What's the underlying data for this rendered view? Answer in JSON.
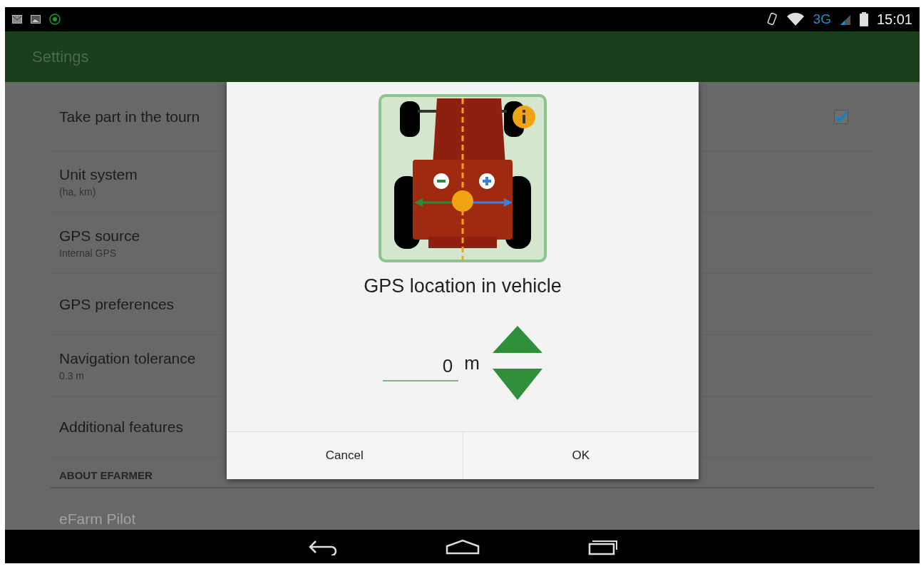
{
  "status_bar": {
    "network": "3G",
    "time": "15:01"
  },
  "action_bar": {
    "title": "Settings"
  },
  "settings": [
    {
      "kind": "checkbox",
      "title": "Take part in the tourn",
      "checked": true,
      "disabled": false
    },
    {
      "kind": "item",
      "title": "Unit system",
      "summary": "(ha, km)",
      "disabled": false
    },
    {
      "kind": "item",
      "title": "GPS source",
      "summary": "Internal GPS",
      "disabled": false
    },
    {
      "kind": "item",
      "title": "GPS preferences",
      "disabled": false
    },
    {
      "kind": "item",
      "title": "Navigation tolerance",
      "summary": "0.3 m",
      "disabled": false
    },
    {
      "kind": "item",
      "title": "Additional features",
      "disabled": false
    },
    {
      "kind": "header",
      "title": "ABOUT EFARMER"
    },
    {
      "kind": "item",
      "title": "eFarm Pilot",
      "disabled": true
    }
  ],
  "dialog": {
    "title": "GPS location in vehicle",
    "value": "0",
    "unit": "m",
    "buttons": [
      "Cancel",
      "OK"
    ]
  }
}
